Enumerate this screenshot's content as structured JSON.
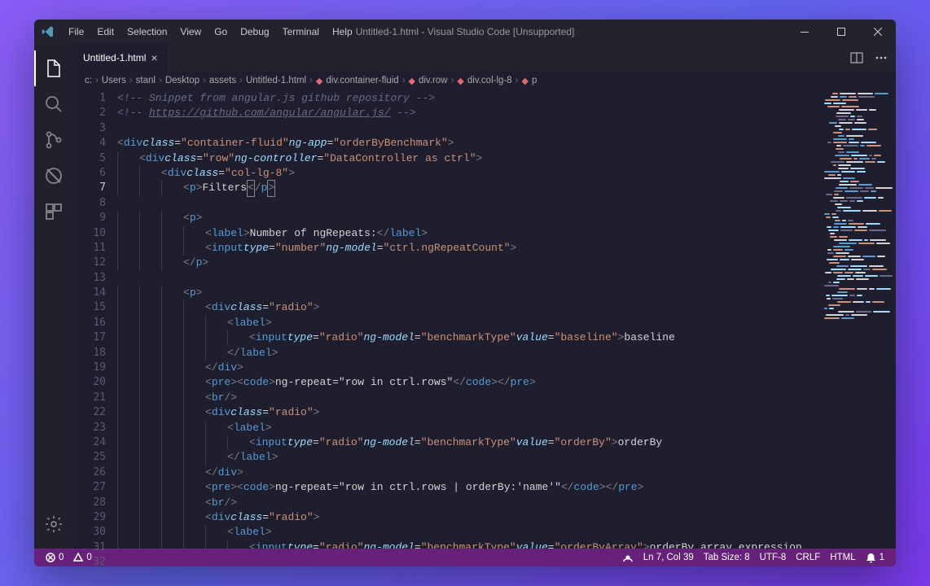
{
  "title": "Untitled-1.html - Visual Studio Code [Unsupported]",
  "menu": [
    "File",
    "Edit",
    "Selection",
    "View",
    "Go",
    "Debug",
    "Terminal",
    "Help"
  ],
  "tab": {
    "label": "Untitled-1.html"
  },
  "breadcrumb": [
    "c:",
    "Users",
    "stanl",
    "Desktop",
    "assets",
    "Untitled-1.html",
    "div.container-fluid",
    "div.row",
    "div.col-lg-8",
    "p"
  ],
  "lines": {
    "count": 32,
    "active": 7
  },
  "code": {
    "l1_comment": "<!-- Snippet from angular.js github repository -->",
    "l2_a": "<!-- ",
    "l2_link": "https://github.com/angular/angular.js/",
    "l2_b": " -->",
    "container_fluid": "container-fluid",
    "orderByBenchmark": "orderByBenchmark",
    "row": "row",
    "DataController": "DataController as ctrl",
    "col_lg_8": "col-lg-8",
    "Filters": "Filters",
    "num_repeats": "Number of ngRepeats:",
    "number": "number",
    "ngRepeatCount": "ctrl.ngRepeatCount",
    "radio": "radio",
    "benchmarkType": "benchmarkType",
    "baseline": "baseline",
    "baseline_txt": "baseline",
    "ngrepeat1": "ng-repeat=\"row in ctrl.rows\"",
    "orderBy": "orderBy",
    "orderBy_txt": "orderBy",
    "ngrepeat2": "ng-repeat=\"row in ctrl.rows | orderBy:'name'\"",
    "orderByArray": "orderByArray",
    "orderByArray_txt": "orderBy array expression",
    "div": "div",
    "p": "p",
    "label": "label",
    "input": "input",
    "pre": "pre",
    "code_tag": "code",
    "br": "br",
    "class": "class",
    "ng_app": "ng-app",
    "ng_controller": "ng-controller",
    "ng_model": "ng-model",
    "type": "type",
    "value": "value"
  },
  "status": {
    "errors": "0",
    "warnings": "0",
    "cursor": "Ln 7, Col 39",
    "tab_size": "Tab Size: 8",
    "encoding": "UTF-8",
    "eol": "CRLF",
    "lang": "HTML",
    "notif": "1"
  }
}
